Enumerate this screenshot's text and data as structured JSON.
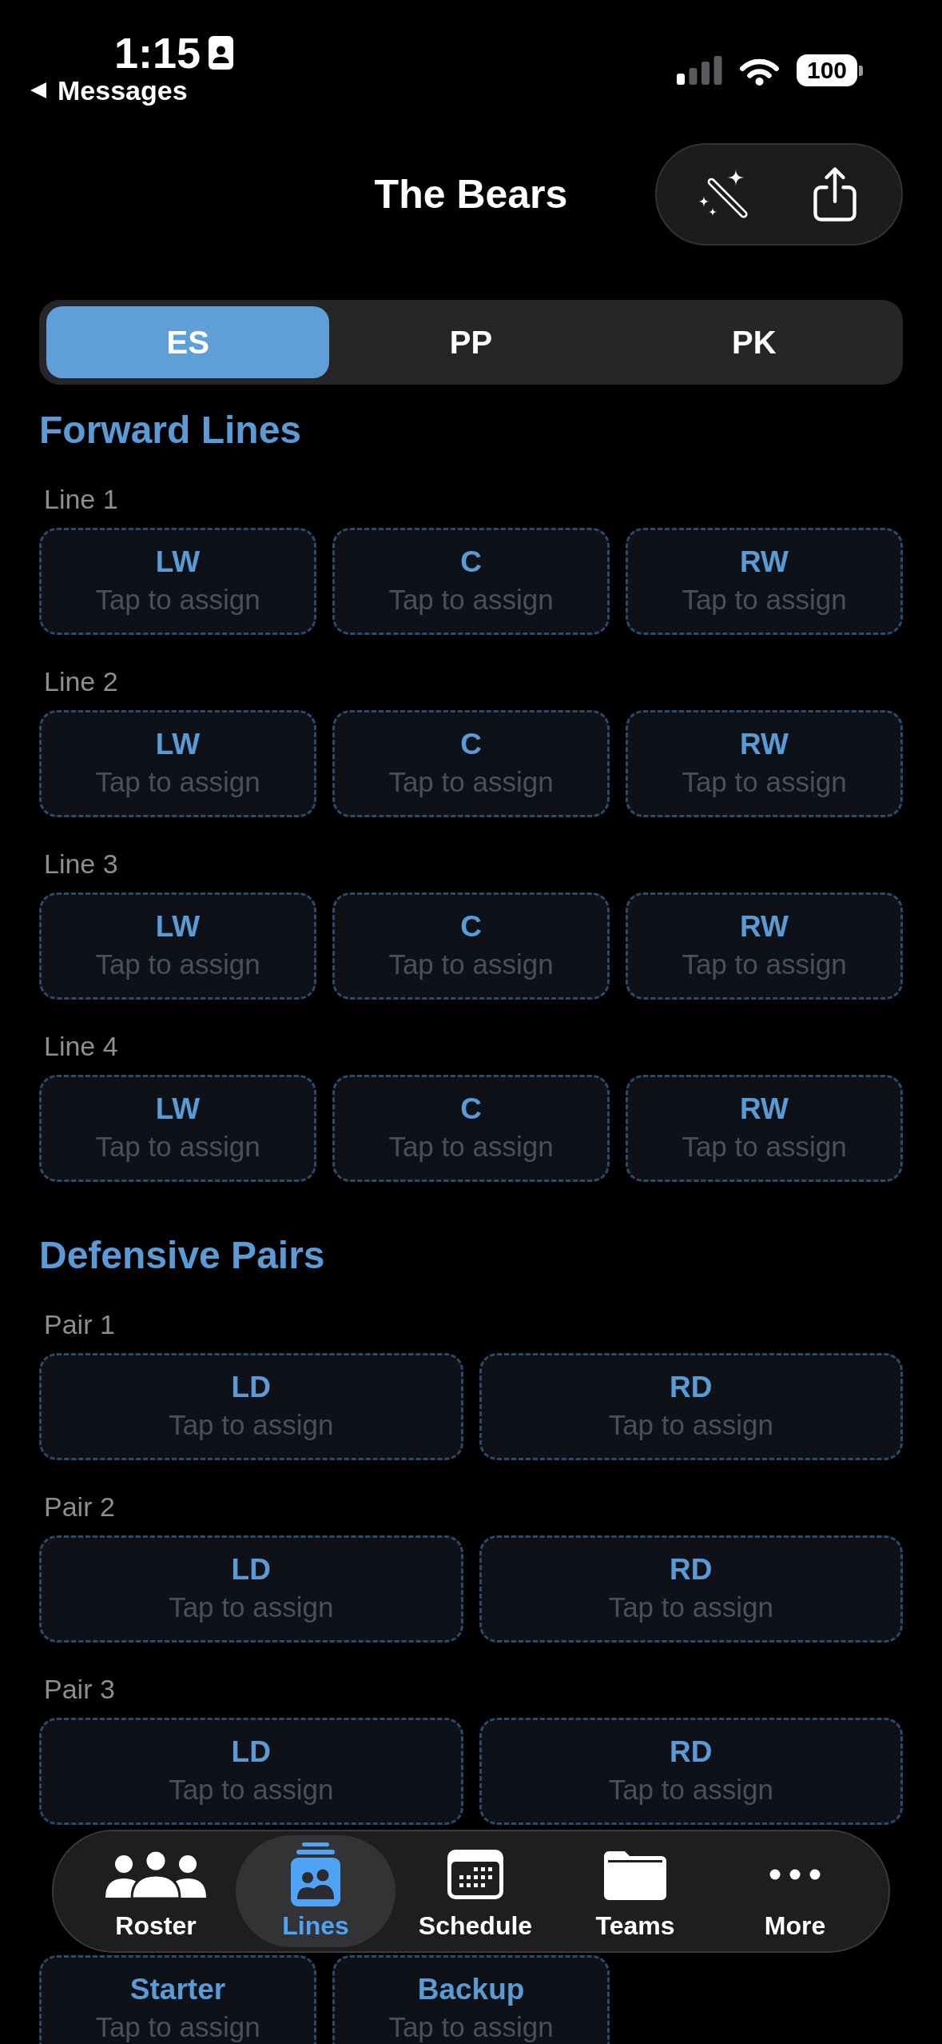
{
  "status_bar": {
    "time": "1:15",
    "back_label": "Messages",
    "battery": "100"
  },
  "header": {
    "title": "The Bears"
  },
  "segments": [
    {
      "label": "ES",
      "selected": true
    },
    {
      "label": "PP",
      "selected": false
    },
    {
      "label": "PK",
      "selected": false
    }
  ],
  "sections": [
    {
      "title": "Forward Lines",
      "kind": "three-column",
      "groups": [
        {
          "label": "Line 1",
          "slots": [
            {
              "position": "LW",
              "hint": "Tap to assign"
            },
            {
              "position": "C",
              "hint": "Tap to assign"
            },
            {
              "position": "RW",
              "hint": "Tap to assign"
            }
          ]
        },
        {
          "label": "Line 2",
          "slots": [
            {
              "position": "LW",
              "hint": "Tap to assign"
            },
            {
              "position": "C",
              "hint": "Tap to assign"
            },
            {
              "position": "RW",
              "hint": "Tap to assign"
            }
          ]
        },
        {
          "label": "Line 3",
          "slots": [
            {
              "position": "LW",
              "hint": "Tap to assign"
            },
            {
              "position": "C",
              "hint": "Tap to assign"
            },
            {
              "position": "RW",
              "hint": "Tap to assign"
            }
          ]
        },
        {
          "label": "Line 4",
          "slots": [
            {
              "position": "LW",
              "hint": "Tap to assign"
            },
            {
              "position": "C",
              "hint": "Tap to assign"
            },
            {
              "position": "RW",
              "hint": "Tap to assign"
            }
          ]
        }
      ]
    },
    {
      "title": "Defensive Pairs",
      "kind": "two-column",
      "groups": [
        {
          "label": "Pair 1",
          "slots": [
            {
              "position": "LD",
              "hint": "Tap to assign"
            },
            {
              "position": "RD",
              "hint": "Tap to assign"
            }
          ]
        },
        {
          "label": "Pair 2",
          "slots": [
            {
              "position": "LD",
              "hint": "Tap to assign"
            },
            {
              "position": "RD",
              "hint": "Tap to assign"
            }
          ]
        },
        {
          "label": "Pair 3",
          "slots": [
            {
              "position": "LD",
              "hint": "Tap to assign"
            },
            {
              "position": "RD",
              "hint": "Tap to assign"
            }
          ]
        }
      ]
    },
    {
      "kind": "three-column",
      "groups": [
        {
          "slots": [
            {
              "position": "Starter",
              "hint": "Tap to assign"
            },
            {
              "position": "Backup",
              "hint": "Tap to assign"
            }
          ]
        }
      ]
    }
  ],
  "tab_bar": [
    {
      "label": "Roster",
      "selected": false
    },
    {
      "label": "Lines",
      "selected": true
    },
    {
      "label": "Schedule",
      "selected": false
    },
    {
      "label": "Teams",
      "selected": false
    },
    {
      "label": "More",
      "selected": false
    }
  ]
}
